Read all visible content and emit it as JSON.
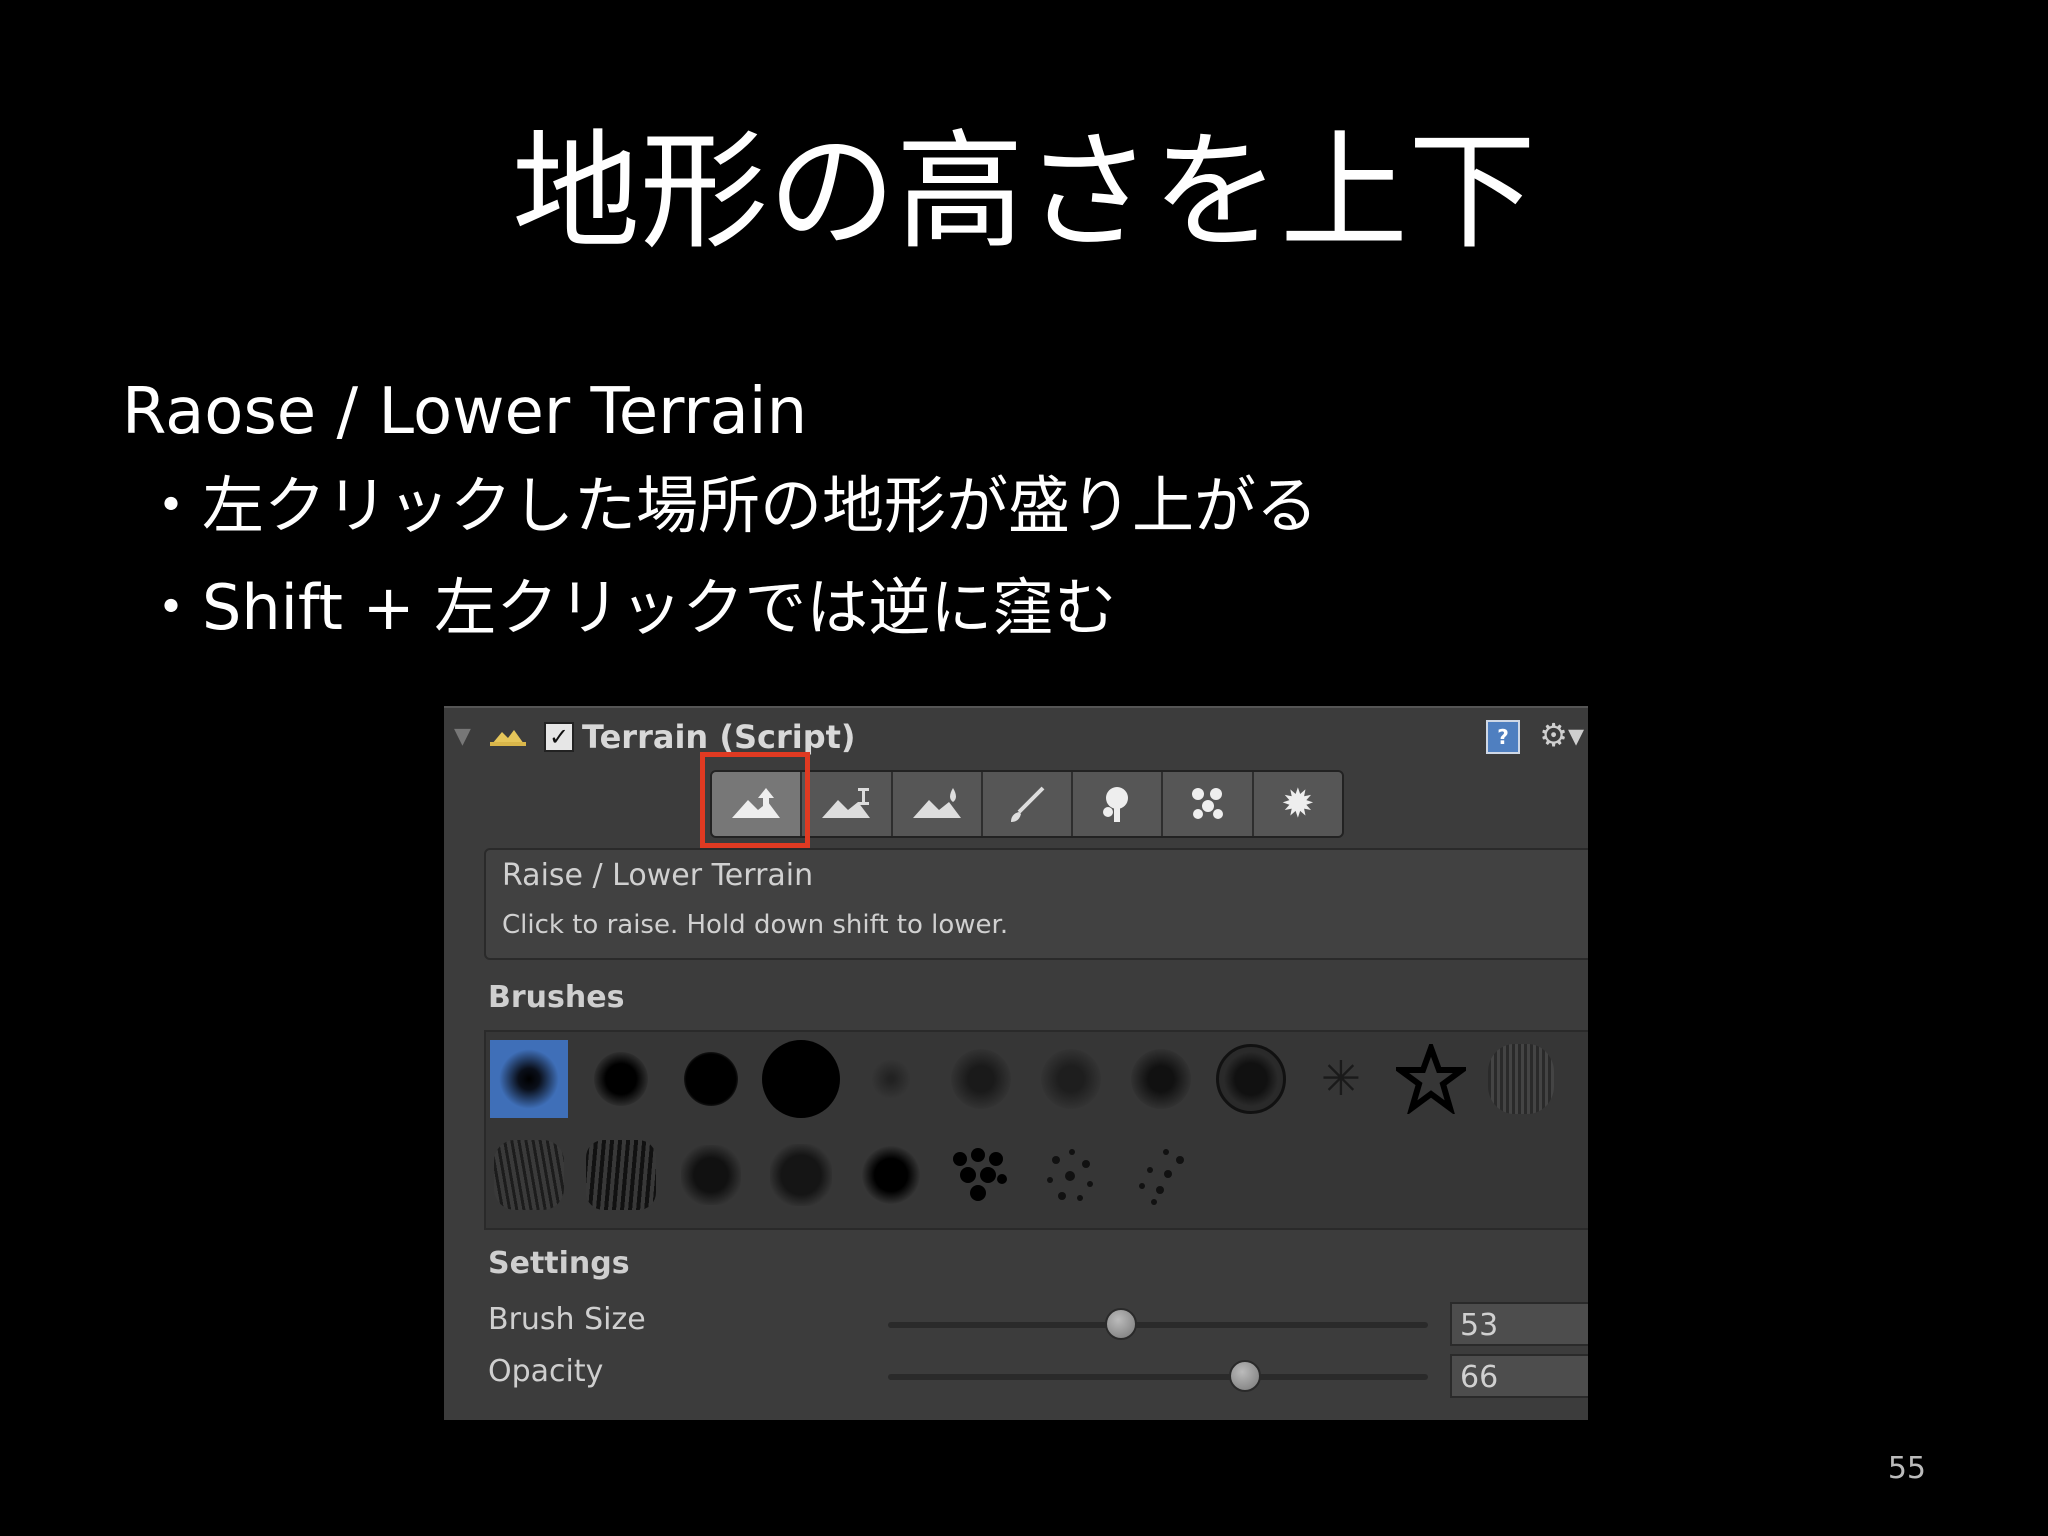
{
  "slide": {
    "title": "地形の高さを上下",
    "subtitle": "Raose / Lower Terrain",
    "bullets": [
      "・左クリックした場所の地形が盛り上がる",
      "・Shift + 左クリックでは逆に窪む"
    ],
    "page_number": "55"
  },
  "inspector": {
    "component_title": "Terrain (Script)",
    "enabled": true,
    "help_icon": "help-icon",
    "settings_icon": "gear-icon",
    "tools": [
      {
        "name": "raise-lower-terrain-tool",
        "icon": "mountain-up-arrow-icon",
        "active": true
      },
      {
        "name": "paint-height-tool",
        "icon": "mountain-height-icon",
        "active": false
      },
      {
        "name": "smooth-height-tool",
        "icon": "mountain-drop-icon",
        "active": false
      },
      {
        "name": "paint-texture-tool",
        "icon": "brush-icon",
        "active": false
      },
      {
        "name": "place-trees-tool",
        "icon": "tree-icon",
        "active": false
      },
      {
        "name": "paint-details-tool",
        "icon": "flowers-icon",
        "active": false
      },
      {
        "name": "terrain-settings-tool",
        "icon": "gear-icon",
        "active": false
      }
    ],
    "tool_description": {
      "title": "Raise / Lower Terrain",
      "text": "Click to raise. Hold down shift to lower."
    },
    "brushes_label": "Brushes",
    "settings_label": "Settings",
    "brush_size": {
      "label": "Brush Size",
      "value": "53",
      "level": 0.43
    },
    "opacity": {
      "label": "Opacity",
      "value": "66",
      "level": 0.66
    },
    "selection_color": "#e03a22"
  }
}
